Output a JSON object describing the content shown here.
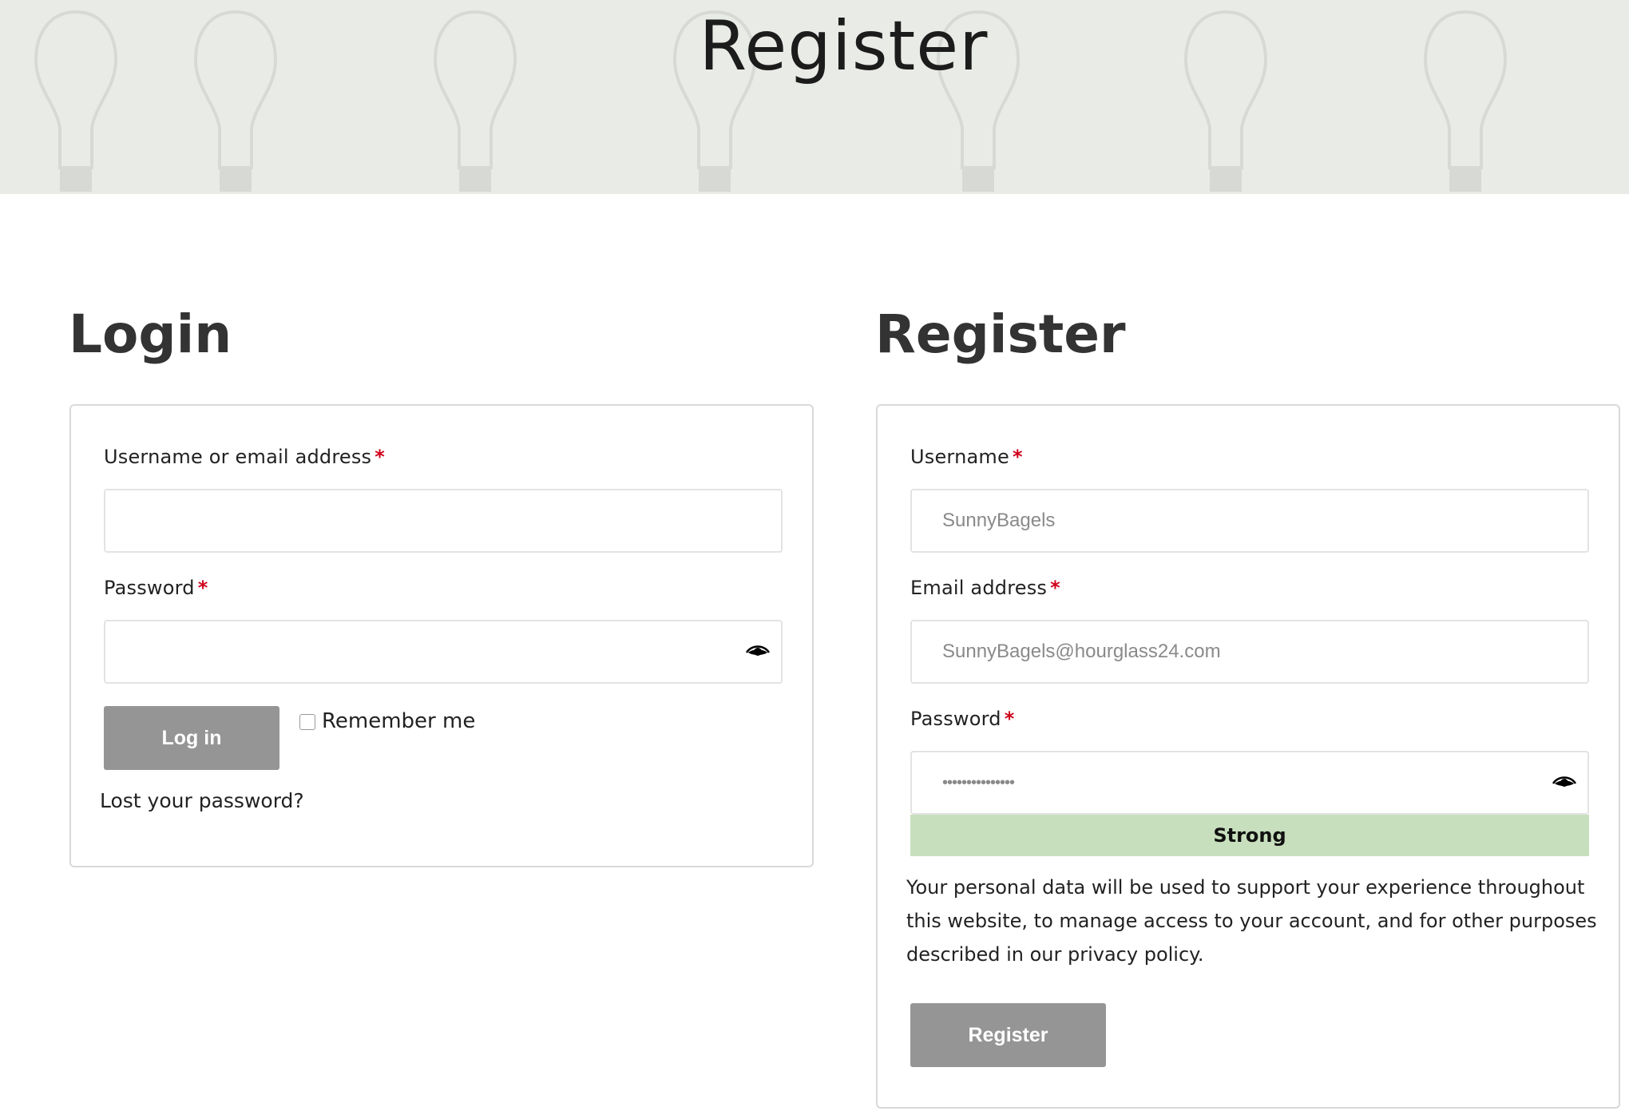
{
  "hero": {
    "title": "Register"
  },
  "login": {
    "title": "Login",
    "username_label": "Username or email address",
    "username_value": "",
    "password_label": "Password",
    "password_value": "",
    "required_mark": "*",
    "login_button": "Log in",
    "remember_label": "Remember me",
    "remember_checked": false,
    "lost_password": "Lost your password?"
  },
  "register": {
    "title": "Register",
    "username_label": "Username",
    "username_value": "SunnyBagels",
    "email_label": "Email address",
    "email_value": "SunnyBagels@hourglass24.com",
    "password_label": "Password",
    "password_value": "•••••••••••••••",
    "required_mark": "*",
    "strength": "Strong",
    "privacy_text": "Your personal data will be used to support your experience throughout this website, to manage access to your account, and for other purposes described in our privacy policy.",
    "register_button": "Register"
  },
  "icons": {
    "password_toggle": "eye-icon",
    "hero_background": "lightbulb-pattern"
  },
  "colors": {
    "required": "#d0021b",
    "button": "#959595",
    "strength_bg": "#c8dfbd",
    "hero_bg": "#e9ebe7"
  }
}
